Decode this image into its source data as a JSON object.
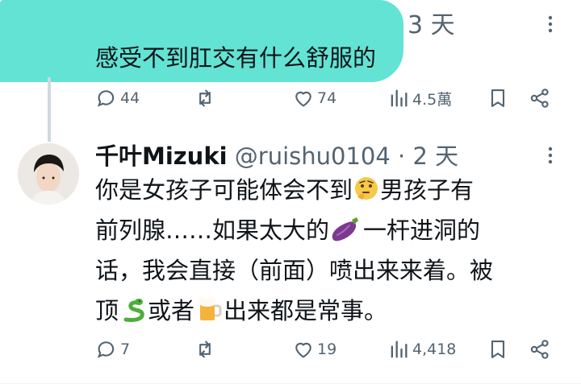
{
  "parent_post": {
    "time": "3 天",
    "text": "感受不到肛交有什么舒服的",
    "stats": {
      "replies": "44",
      "likes": "74",
      "views": "4.5萬"
    }
  },
  "reply_post": {
    "display_name": "千叶Mizuki",
    "handle": "@ruishu0104",
    "separator": "·",
    "time": "2 天",
    "text_lines": [
      {
        "before": "你是女孩子可能体会不到",
        "emoji": "thinking-face",
        "after": "男孩子有"
      },
      {
        "before": "前列腺……如果太大的",
        "emoji": "eggplant",
        "after": "一杆进洞的"
      },
      {
        "before": "话，我会直接（前面）喷出来来着。被",
        "emoji": "",
        "after": ""
      },
      {
        "before": "顶",
        "emoji": "snake",
        "after": "或者",
        "emoji2": "beer-mug",
        "after2": "出来都是常事。"
      }
    ],
    "stats": {
      "replies": "7",
      "likes": "19",
      "views": "4,418"
    }
  },
  "icons": {
    "reply": "reply-icon",
    "repost": "repost-icon",
    "like": "heart-icon",
    "views": "views-icon",
    "bookmark": "bookmark-icon",
    "share": "share-icon",
    "more": "more-icon"
  },
  "colors": {
    "muted": "#536471",
    "text": "#0f1419",
    "redaction": "#52e0cf"
  }
}
